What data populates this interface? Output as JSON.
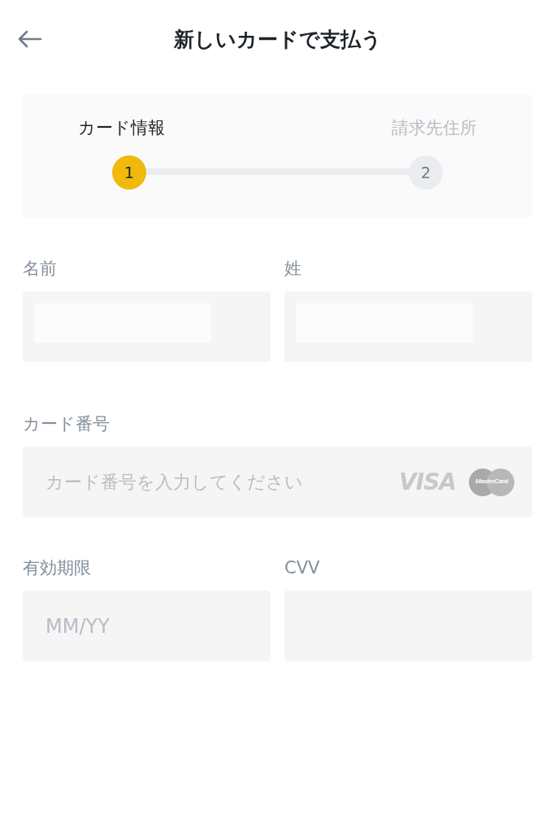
{
  "header": {
    "title": "新しいカードで支払う"
  },
  "steps": [
    {
      "label": "カード情報",
      "number": "1",
      "selected": true
    },
    {
      "label": "請求先住所",
      "number": "2",
      "selected": false
    }
  ],
  "name_fields": [
    {
      "label": "名前",
      "masked": true
    },
    {
      "label": "姓",
      "masked": true
    }
  ],
  "card_number": {
    "label": "カード番号",
    "placeholder": "カード番号を入力してください",
    "brands": [
      "VISA",
      "MasterCard"
    ]
  },
  "bottom_fields": [
    {
      "label": "有効期限",
      "placeholder": "MM/YY"
    },
    {
      "label": "CVV"
    }
  ]
}
